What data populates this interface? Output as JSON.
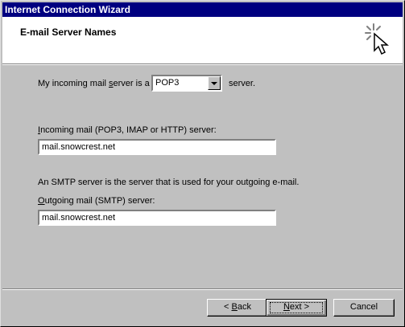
{
  "window": {
    "title": "Internet Connection Wizard"
  },
  "header": {
    "title": "E-mail Server Names",
    "icon": "wizard-cursor-sparkle-icon"
  },
  "incoming_type": {
    "label_before": "My incoming mail ",
    "label_underlined": "s",
    "label_after": "erver is a",
    "selected": "POP3",
    "suffix": "server."
  },
  "incoming_server": {
    "label_underlined": "I",
    "label_rest": "ncoming mail (POP3, IMAP or HTTP) server:",
    "value": "mail.snowcrest.net"
  },
  "smtp_note": "An SMTP server is the server that is used for your outgoing e-mail.",
  "outgoing_server": {
    "label_underlined": "O",
    "label_rest": "utgoing mail (SMTP) server:",
    "value": "mail.snowcrest.net"
  },
  "buttons": {
    "back_prefix": "< ",
    "back_underlined": "B",
    "back_rest": "ack",
    "next_underlined": "N",
    "next_rest": "ext >",
    "cancel": "Cancel"
  }
}
